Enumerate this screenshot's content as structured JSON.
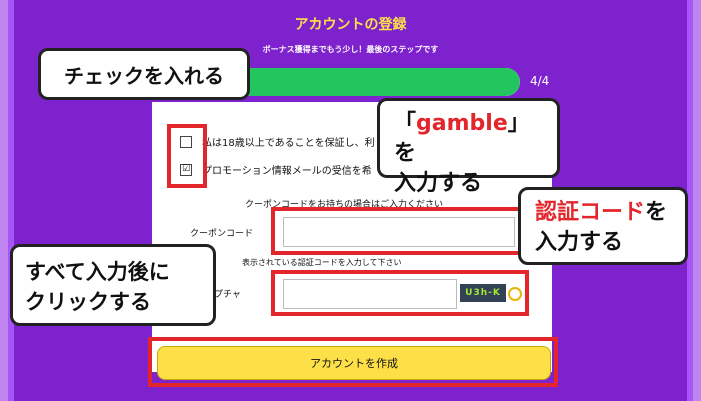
{
  "header": {
    "title": "アカウントの登録",
    "subtitle": "ボーナス獲得までもう少し！最後のステップです",
    "step": "4/4"
  },
  "progress": {
    "value": 1.0
  },
  "form": {
    "checkbox1": {
      "label": "私は18歳以上であることを保証し、利",
      "checked": false
    },
    "checkbox2": {
      "label": "プロモーション情報メールの受信を希",
      "checked": true,
      "mark": "☑"
    },
    "coupon_hint": "クーポンコードをお持ちの場合はご入力ください",
    "coupon_label": "クーポンコード",
    "coupon_value": "",
    "captcha_hint": "表示されている認証コードを入力して下さい",
    "captcha_label": "キャプチャ",
    "captcha_value": "",
    "captcha_code": "U3h-K",
    "create_label": "アカウントを作成"
  },
  "annotations": {
    "check": "チェックを入れる",
    "gamble_quote_open": "「",
    "gamble_word": "gamble",
    "gamble_quote_close": "」を",
    "gamble_line2": "入力する",
    "captcha_word": "認証コード",
    "captcha_suffix": "を",
    "captcha_line2": "入力する",
    "submit_line1": "すべて入力後に",
    "submit_line2": "クリックする"
  },
  "colors": {
    "purple": "#7e22ce",
    "yellow": "#fde047",
    "green": "#22c55e",
    "red": "#e3262b"
  }
}
